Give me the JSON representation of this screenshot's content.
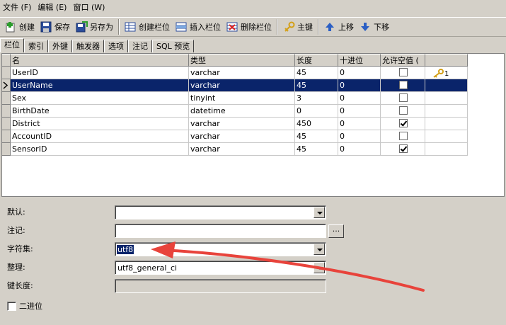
{
  "menu": [
    {
      "label": "文件 (F)"
    },
    {
      "label": "编辑 (E)"
    },
    {
      "label": "窗口 (W)"
    }
  ],
  "toolbar": {
    "create": "创建",
    "save": "保存",
    "save_as": "另存为",
    "create_field": "创建栏位",
    "insert_field": "插入栏位",
    "delete_field": "删除栏位",
    "primary_key": "主键",
    "move_up": "上移",
    "move_down": "下移"
  },
  "tabs": [
    "栏位",
    "索引",
    "外键",
    "触发器",
    "选项",
    "注记",
    "SQL 预览"
  ],
  "grid": {
    "headers": [
      "名",
      "类型",
      "长度",
      "十进位",
      "允许空值 (",
      ""
    ],
    "rows": [
      {
        "name": "UserID",
        "type": "varchar",
        "length": "45",
        "decimal": "0",
        "nullable": false,
        "pk": "1"
      },
      {
        "name": "UserName",
        "type": "varchar",
        "length": "45",
        "decimal": "0",
        "nullable": false,
        "pk": ""
      },
      {
        "name": "Sex",
        "type": "tinyint",
        "length": "3",
        "decimal": "0",
        "nullable": false,
        "pk": ""
      },
      {
        "name": "BirthDate",
        "type": "datetime",
        "length": "0",
        "decimal": "0",
        "nullable": false,
        "pk": ""
      },
      {
        "name": "District",
        "type": "varchar",
        "length": "450",
        "decimal": "0",
        "nullable": true,
        "pk": ""
      },
      {
        "name": "AccountID",
        "type": "varchar",
        "length": "45",
        "decimal": "0",
        "nullable": false,
        "pk": ""
      },
      {
        "name": "SensorID",
        "type": "varchar",
        "length": "45",
        "decimal": "0",
        "nullable": true,
        "pk": ""
      }
    ],
    "selected_row": 1
  },
  "form": {
    "default_label": "默认:",
    "default_value": "",
    "comment_label": "注记:",
    "comment_value": "",
    "ellipsis": "...",
    "charset_label": "字符集:",
    "charset_value": "utf8",
    "collation_label": "整理:",
    "collation_value": "utf8_general_ci",
    "key_length_label": "键长度:",
    "key_length_value": "",
    "binary_label": "二进位"
  },
  "colors": {
    "selection": "#0a246a",
    "annotation_arrow": "#e8433b",
    "key_icon": "#d4a017"
  }
}
